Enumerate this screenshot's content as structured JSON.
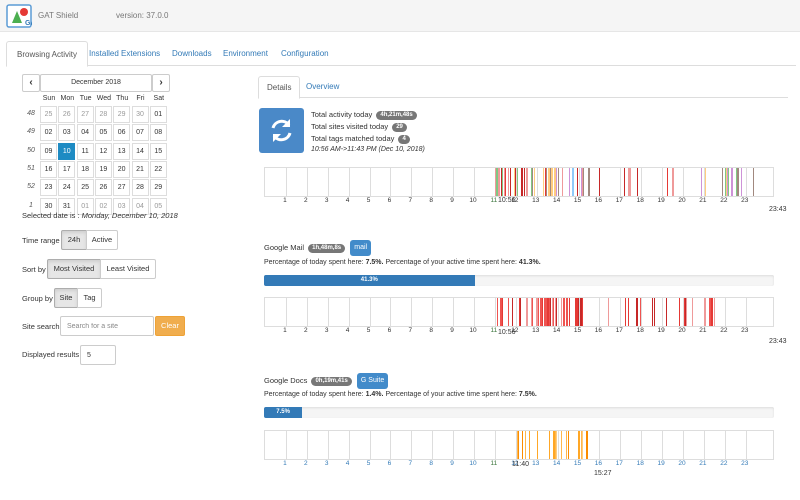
{
  "app": {
    "title": "GAT Shield",
    "version": "version: 37.0.0"
  },
  "tabs": [
    {
      "label": "Browsing Activity",
      "active": true
    },
    {
      "label": "Installed Extensions"
    },
    {
      "label": "Downloads"
    },
    {
      "label": "Environment"
    },
    {
      "label": "Configuration"
    }
  ],
  "calendar": {
    "month_label": "December 2018",
    "prev": "‹",
    "next": "›",
    "dow": [
      "Sun",
      "Mon",
      "Tue",
      "Wed",
      "Thu",
      "Fri",
      "Sat"
    ],
    "weeks": [
      {
        "wk": "48",
        "days": [
          "25",
          "26",
          "27",
          "28",
          "29",
          "30",
          "01"
        ]
      },
      {
        "wk": "49",
        "days": [
          "02",
          "03",
          "04",
          "05",
          "06",
          "07",
          "08"
        ]
      },
      {
        "wk": "50",
        "days": [
          "09",
          "10",
          "11",
          "12",
          "13",
          "14",
          "15"
        ]
      },
      {
        "wk": "51",
        "days": [
          "16",
          "17",
          "18",
          "19",
          "20",
          "21",
          "22"
        ]
      },
      {
        "wk": "52",
        "days": [
          "23",
          "24",
          "25",
          "26",
          "27",
          "28",
          "29"
        ]
      },
      {
        "wk": "1",
        "days": [
          "30",
          "31",
          "01",
          "02",
          "03",
          "04",
          "05"
        ]
      }
    ],
    "selected": "10"
  },
  "selected_date": {
    "label": "Selected date is : ",
    "value": "Monday, December 10, 2018"
  },
  "controls": {
    "time_range": {
      "label": "Time range",
      "options": [
        "24h",
        "Active"
      ],
      "selected": "24h"
    },
    "sort_by": {
      "label": "Sort by",
      "options": [
        "Most Visited",
        "Least Visited"
      ],
      "selected": "Most Visited"
    },
    "group_by": {
      "label": "Group by",
      "options": [
        "Site",
        "Tag"
      ],
      "selected": "Site"
    },
    "site_search": {
      "label": "Site search",
      "placeholder": "Search for a site",
      "clear": "Clear"
    },
    "displayed_results": {
      "label": "Displayed results",
      "value": "5"
    }
  },
  "subtabs": [
    {
      "label": "Details",
      "active": true
    },
    {
      "label": "Overview"
    }
  ],
  "summary": {
    "total_activity_label": "Total activity today",
    "total_activity_value": "4h,21m,48s",
    "sites_label": "Total sites visited today",
    "sites_value": "29",
    "tags_label": "Total tags matched today",
    "tags_value": "4",
    "time_range": "10:56 AM->11:43 PM (Dec 10, 2018)",
    "icon": "refresh-icon"
  },
  "hours": [
    "1",
    "2",
    "3",
    "4",
    "5",
    "6",
    "7",
    "8",
    "9",
    "10",
    "11",
    "12",
    "13",
    "14",
    "15",
    "16",
    "17",
    "18",
    "19",
    "20",
    "21",
    "22",
    "23"
  ],
  "timelines": [
    {
      "start": "10:56",
      "end": "23:43",
      "palette": "mixed"
    },
    {
      "start": "10:56",
      "end": "23:43",
      "palette": "red"
    },
    {
      "start": "11:40",
      "end": "15:27",
      "palette": "orange"
    }
  ],
  "sites": [
    {
      "name": "Google Mail",
      "duration": "1h,48m,8s",
      "tag": "mail",
      "pct_today_label": "Percentage of today spent here:",
      "pct_today": "7.5%.",
      "pct_active_label": "Percentage of your active time spent here:",
      "pct_active": "41.3%.",
      "bar_label": "41.3%",
      "bar_fraction": 0.413
    },
    {
      "name": "Google Docs",
      "duration": "0h,19m,41s",
      "tag": "G Suite",
      "pct_today_label": "Percentage of today spent here:",
      "pct_today": "1.4%.",
      "pct_active_label": "Percentage of your active time spent here:",
      "pct_active": "7.5%.",
      "bar_label": "7.5%",
      "bar_fraction": 0.075
    }
  ],
  "colors": {
    "accent": "#337ab7",
    "selected_day": "#1e8bc3",
    "clear": "#f0ad4e",
    "icon_bg": "#4a89c8"
  }
}
